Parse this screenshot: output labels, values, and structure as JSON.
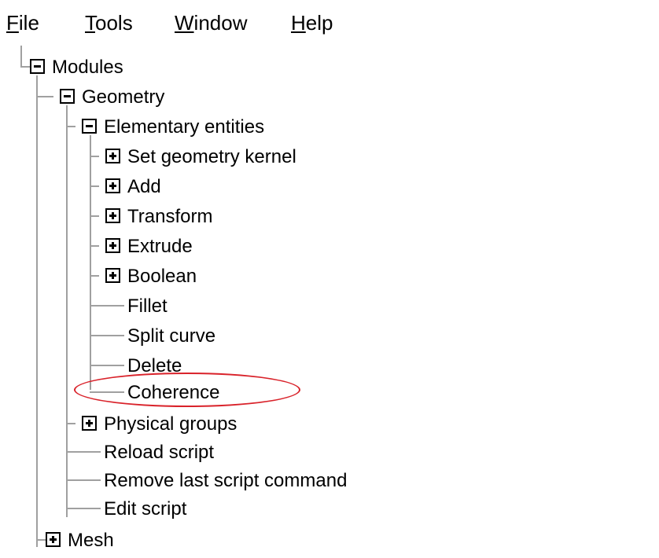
{
  "menubar": {
    "items": [
      {
        "label_hot": "F",
        "label_rest": "ile"
      },
      {
        "label_hot": "T",
        "label_rest": "ools"
      },
      {
        "label_hot": "W",
        "label_rest": "indow"
      },
      {
        "label_hot": "H",
        "label_rest": "elp"
      }
    ]
  },
  "tree": {
    "modules": "Modules",
    "geometry": "Geometry",
    "elementary_entities": "Elementary entities",
    "set_geometry_kernel": "Set geometry kernel",
    "add": "Add",
    "transform": "Transform",
    "extrude": "Extrude",
    "boolean": "Boolean",
    "fillet": "Fillet",
    "split_curve": "Split curve",
    "delete": "Delete",
    "coherence": "Coherence",
    "physical_groups": "Physical groups",
    "reload_script": "Reload script",
    "remove_last_script_command": "Remove last script command",
    "edit_script": "Edit script",
    "mesh": "Mesh"
  },
  "annotation": {
    "highlight_color": "#d9222a",
    "highlighted_item": "Coherence"
  }
}
